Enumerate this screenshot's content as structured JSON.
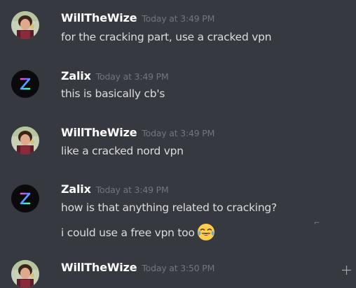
{
  "messages": [
    {
      "author": "WillTheWize",
      "timestamp": "Today at 3:49 PM",
      "avatar": "willthewize-avatar",
      "lines": [
        "for the cracking part, use a cracked vpn"
      ]
    },
    {
      "author": "Zalix",
      "timestamp": "Today at 3:49 PM",
      "avatar": "zalix-avatar",
      "lines": [
        "this is basically cb's"
      ]
    },
    {
      "author": "WillTheWize",
      "timestamp": "Today at 3:49 PM",
      "avatar": "willthewize-avatar",
      "lines": [
        "like a cracked nord vpn"
      ]
    },
    {
      "author": "Zalix",
      "timestamp": "Today at 3:49 PM",
      "avatar": "zalix-avatar",
      "lines": [
        "how is that anything related to cracking?",
        "i could use a free vpn too"
      ],
      "emoji": "joy-emoji"
    },
    {
      "author": "WillTheWize",
      "timestamp": "Today at 3:50 PM",
      "avatar": "willthewize-avatar",
      "lines": []
    }
  ],
  "colors": {
    "background": "#36393f",
    "username": "#ffffff",
    "timestamp": "#72767d",
    "message_text": "#dcddde"
  },
  "icons": {
    "bottom_right": "plus-icon"
  }
}
